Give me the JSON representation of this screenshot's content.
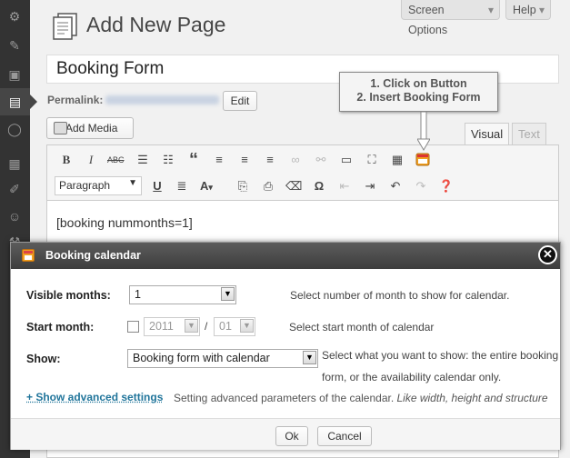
{
  "header": {
    "title": "Add New Page",
    "screen_options": "Screen Options",
    "help": "Help"
  },
  "post": {
    "title_value": "Booking Form",
    "permalink_label": "Permalink:",
    "edit_label": "Edit"
  },
  "media": {
    "add_media_label": "Add Media"
  },
  "editor": {
    "tabs": [
      "Visual",
      "Text"
    ],
    "active_tab": "Visual",
    "format_select": "Paragraph",
    "content": "[booking nummonths=1]"
  },
  "callout": {
    "line1": "1. Click on Button",
    "line2": "2. Insert Booking Form"
  },
  "modal": {
    "title": "Booking calendar",
    "close_glyph": "✕",
    "visible_months": {
      "label": "Visible months:",
      "value": "1",
      "description": "Select number of month to show for calendar."
    },
    "start_month": {
      "label": "Start month:",
      "year": "2011",
      "separator": "/",
      "month": "01",
      "checked": false,
      "description": "Select start month of calendar"
    },
    "show": {
      "label": "Show:",
      "value": "Booking form with calendar",
      "description_line1": "Select what you want to show: the entire booking",
      "description_line2": "form, or the availability calendar only."
    },
    "advanced": {
      "link": "+ Show advanced settings",
      "description": "Setting advanced parameters of the calendar.",
      "description_italic": "Like width, height and structure"
    },
    "ok_label": "Ok",
    "cancel_label": "Cancel"
  },
  "colors": {
    "sidebar_bg": "#333333",
    "link": "#21759b",
    "modal_header": "#4a4a4a"
  }
}
